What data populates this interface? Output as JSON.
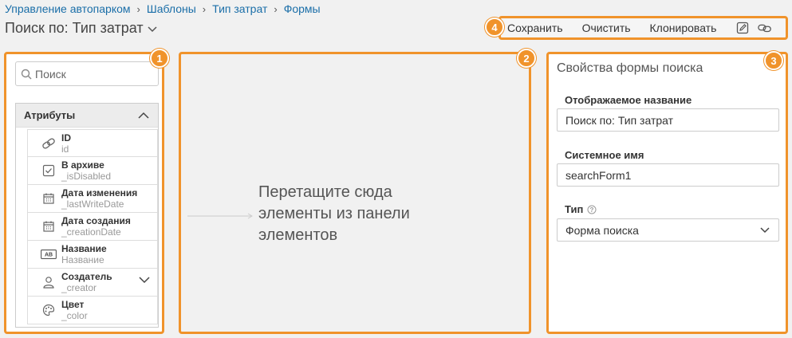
{
  "breadcrumb": [
    "Управление автопарком",
    "Шаблоны",
    "Тип затрат",
    "Формы"
  ],
  "page_title": "Поиск по: Тип затрат",
  "toolbar": {
    "save_label": "Сохранить",
    "clear_label": "Очистить",
    "clone_label": "Клонировать",
    "icons": [
      "edit-icon",
      "link-icon"
    ]
  },
  "badges": [
    "1",
    "2",
    "3",
    "4"
  ],
  "left_panel": {
    "search_placeholder": "Поиск",
    "section_title": "Атрибуты",
    "attributes": [
      {
        "name": "ID",
        "system": "id",
        "icon": "link-icon"
      },
      {
        "name": "В архиве",
        "system": "_isDisabled",
        "icon": "checkbox-icon"
      },
      {
        "name": "Дата изменения",
        "system": "_lastWriteDate",
        "icon": "calendar-icon"
      },
      {
        "name": "Дата создания",
        "system": "_creationDate",
        "icon": "calendar-icon"
      },
      {
        "name": "Название",
        "system": "Название",
        "icon": "text-field-icon"
      },
      {
        "name": "Создатель",
        "system": "_creator",
        "icon": "user-icon"
      },
      {
        "name": "Цвет",
        "system": "_color",
        "icon": "palette-icon"
      }
    ]
  },
  "center_panel": {
    "drop_hint": "Перетащите сюда элементы из панели элементов"
  },
  "right_panel": {
    "title": "Свойства формы поиска",
    "display_name_label": "Отображаемое название",
    "display_name_value": "Поиск по: Тип затрат",
    "system_name_label": "Системное имя",
    "system_name_value": "searchForm1",
    "type_label": "Тип",
    "type_value": "Форма поиска"
  },
  "colors": {
    "accent": "#f0932b",
    "link": "#1a6ea8"
  }
}
